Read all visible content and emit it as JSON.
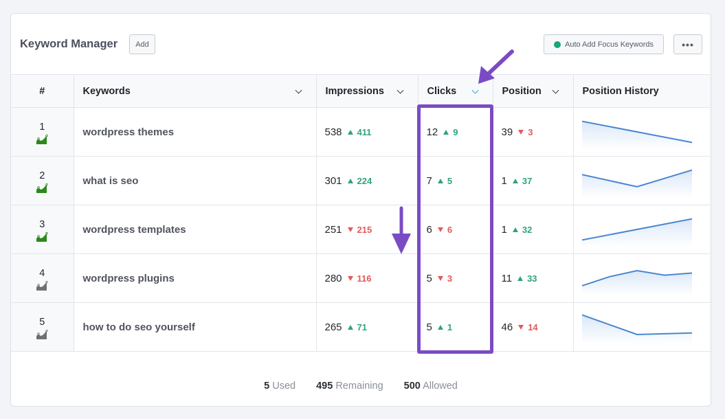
{
  "header": {
    "title": "Keyword Manager",
    "add_label": "Add",
    "auto_add_label": "Auto Add Focus Keywords",
    "auto_add_status_color": "#17a57a",
    "more_label": "•••"
  },
  "columns": {
    "num": "#",
    "keywords": "Keywords",
    "impressions": "Impressions",
    "clicks": "Clicks",
    "position": "Position",
    "position_history": "Position History"
  },
  "sorted_column": "clicks",
  "rows": [
    {
      "num": "1",
      "trend_icon": "trend-chart-icon",
      "trend_color": "#2a8a1a",
      "keyword": "wordpress themes",
      "impressions": "538",
      "impressions_delta": "411",
      "impressions_dir": "up",
      "clicks": "12",
      "clicks_delta": "9",
      "clicks_dir": "up",
      "position": "39",
      "position_delta": "3",
      "position_dir": "down",
      "history": [
        0.15,
        0.85
      ]
    },
    {
      "num": "2",
      "trend_icon": "trend-chart-icon",
      "trend_color": "#2a8a1a",
      "keyword": "what is seo",
      "impressions": "301",
      "impressions_delta": "224",
      "impressions_dir": "up",
      "clicks": "7",
      "clicks_delta": "5",
      "clicks_dir": "up",
      "position": "1",
      "position_delta": "37",
      "position_dir": "up",
      "history": [
        0.3,
        0.7,
        0.15
      ]
    },
    {
      "num": "3",
      "trend_icon": "trend-chart-icon",
      "trend_color": "#2a8a1a",
      "keyword": "wordpress templates",
      "impressions": "251",
      "impressions_delta": "215",
      "impressions_dir": "down",
      "clicks": "6",
      "clicks_delta": "6",
      "clicks_dir": "down",
      "position": "1",
      "position_delta": "32",
      "position_dir": "up",
      "history": [
        0.85,
        0.15
      ]
    },
    {
      "num": "4",
      "trend_icon": "trend-chart-icon",
      "trend_color": "#707070",
      "keyword": "wordpress plugins",
      "impressions": "280",
      "impressions_delta": "116",
      "impressions_dir": "down",
      "clicks": "5",
      "clicks_delta": "3",
      "clicks_dir": "down",
      "position": "11",
      "position_delta": "33",
      "position_dir": "up",
      "history": [
        0.75,
        0.45,
        0.25,
        0.4,
        0.33
      ]
    },
    {
      "num": "5",
      "trend_icon": "trend-chart-icon",
      "trend_color": "#707070",
      "keyword": "how to do seo yourself",
      "impressions": "265",
      "impressions_delta": "71",
      "impressions_dir": "up",
      "clicks": "5",
      "clicks_delta": "1",
      "clicks_dir": "up",
      "position": "46",
      "position_delta": "14",
      "position_dir": "down",
      "history": [
        0.1,
        0.75,
        0.7
      ]
    }
  ],
  "footer": {
    "used_count": "5",
    "used_label": "Used",
    "remaining_count": "495",
    "remaining_label": "Remaining",
    "allowed_count": "500",
    "allowed_label": "Allowed"
  },
  "colors": {
    "up": "#2fa37c",
    "down": "#e35a5a",
    "annotation": "#7b4bc4",
    "sort_active": "#2ea3d4",
    "history_line": "#4a86d0"
  }
}
